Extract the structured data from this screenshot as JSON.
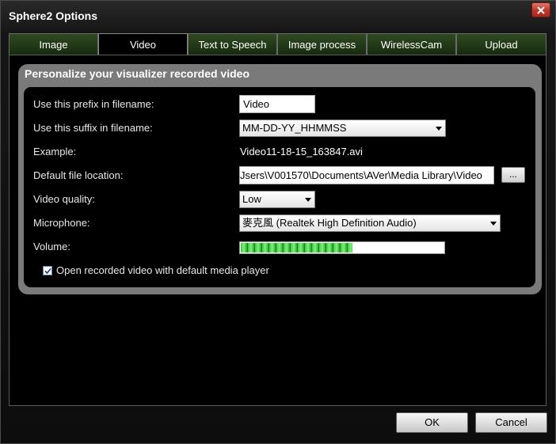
{
  "window": {
    "title": "Sphere2 Options"
  },
  "tabs": [
    {
      "label": "Image"
    },
    {
      "label": "Video",
      "active": true
    },
    {
      "label": "Text to Speech"
    },
    {
      "label": "Image process"
    },
    {
      "label": "WirelessCam"
    },
    {
      "label": "Upload"
    }
  ],
  "video": {
    "group_title": "Personalize your visualizer recorded video",
    "prefix_label": "Use this prefix in filename:",
    "prefix_value": "Video",
    "suffix_label": "Use this suffix in filename:",
    "suffix_value": "MM-DD-YY_HHMMSS",
    "example_label": "Example:",
    "example_value": "Video11-18-15_163847.avi",
    "location_label": "Default file location:",
    "location_value": "Jsers\\V001570\\Documents\\AVer\\Media Library\\Video",
    "browse_label": "...",
    "quality_label": "Video quality:",
    "quality_value": "Low",
    "microphone_label": "Microphone:",
    "microphone_value": "麥克風 (Realtek High Definition Audio)",
    "volume_label": "Volume:",
    "volume_level": 0.55,
    "open_player_label": "Open recorded video with default media player",
    "open_player_checked": true
  },
  "buttons": {
    "ok": "OK",
    "cancel": "Cancel"
  },
  "colors": {
    "tab_inactive": "#1f3a14",
    "group_bg": "#7a7a7a",
    "volume_fill": "#3ccb3c",
    "close_button": "#c0392b"
  }
}
